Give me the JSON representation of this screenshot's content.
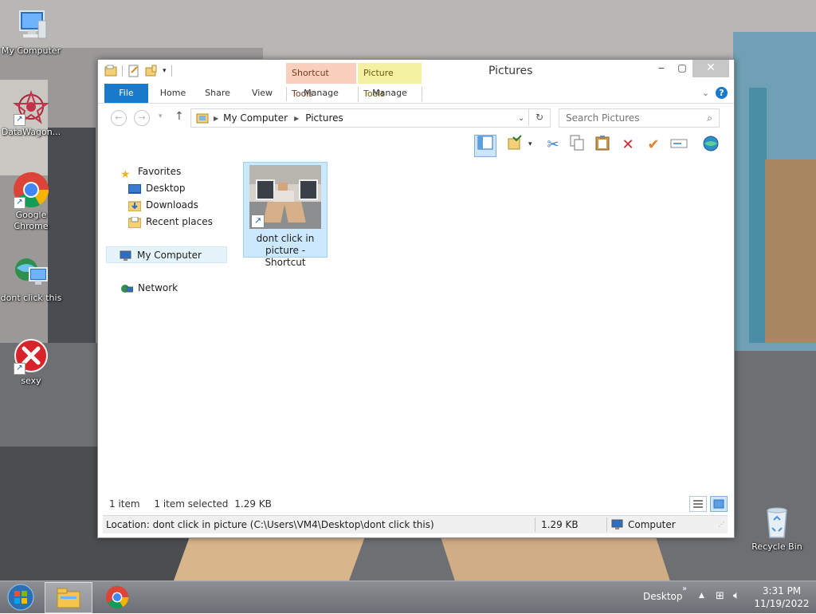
{
  "desktop": {
    "icons": [
      {
        "label": "My Computer"
      },
      {
        "label": "DataWagon..."
      },
      {
        "label": "Google Chrome"
      },
      {
        "label": "dont click this"
      },
      {
        "label": "sexy"
      },
      {
        "label": "Recycle Bin"
      }
    ]
  },
  "window": {
    "title": "Pictures",
    "context_tabs": {
      "shortcut_tools": "Shortcut Tools",
      "picture_tools": "Picture Tools"
    },
    "ribbon_tabs": {
      "file": "File",
      "home": "Home",
      "share": "Share",
      "view": "View",
      "manage1": "Manage",
      "manage2": "Manage"
    },
    "address": {
      "crumbs": [
        "My Computer",
        "Pictures"
      ]
    },
    "search": {
      "placeholder": "Search Pictures"
    },
    "nav": {
      "favorites": "Favorites",
      "desktop": "Desktop",
      "downloads": "Downloads",
      "recent": "Recent places",
      "computer": "My Computer",
      "network": "Network"
    },
    "files": [
      {
        "name_line1": "dont click in",
        "name_line2": "picture - Shortcut"
      }
    ],
    "status": {
      "count": "1 item",
      "selected": "1 item selected",
      "size": "1.29 KB"
    },
    "details_bar": {
      "location": "Location: dont click in picture (C:\\Users\\VM4\\Desktop\\dont click this)",
      "size": "1.29 KB",
      "zone": "Computer"
    }
  },
  "taskbar": {
    "desktop_label": "Desktop",
    "chevron": "»",
    "time": "3:31 PM",
    "date": "11/19/2022"
  },
  "colors": {
    "accent": "#1979ca",
    "selection": "#cce8ff",
    "shortcut_tools": "#f8d0bd",
    "picture_tools": "#f4f0a1"
  }
}
